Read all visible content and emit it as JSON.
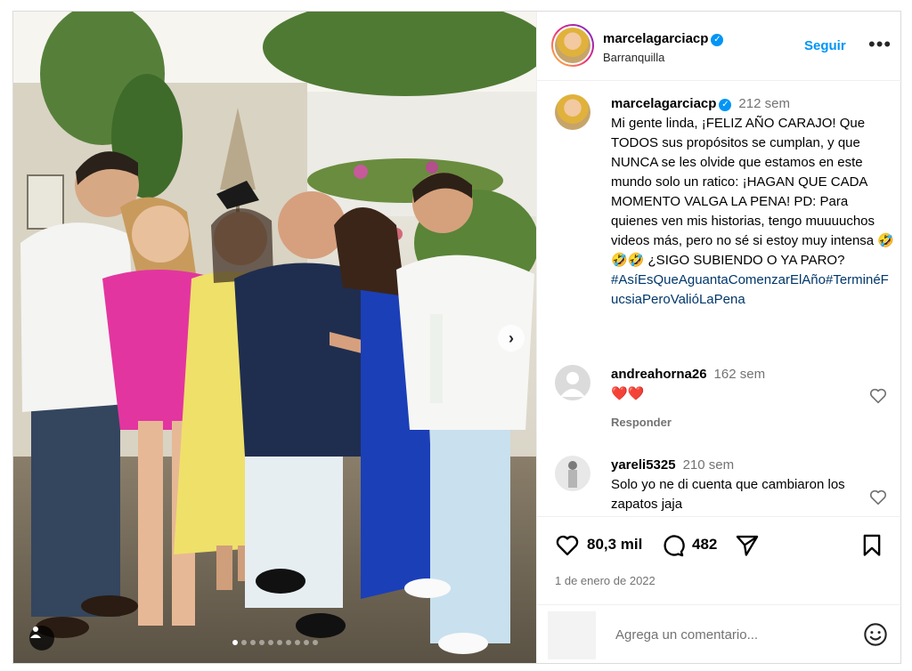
{
  "post": {
    "username": "marcelagarciacp",
    "location": "Barranquilla",
    "follow_label": "Seguir",
    "more_label": "•••",
    "next_label": "›",
    "carousel_count": 10,
    "carousel_active": 1
  },
  "caption": {
    "username": "marcelagarciacp",
    "time": "212 sem",
    "text": "Mi gente linda, ¡FELIZ AÑO CARAJO! Que TODOS sus propósitos se cumplan, y que NUNCA se les olvide que estamos en este mundo solo un ratico: ¡HAGAN QUE CADA MOMENTO VALGA LA PENA! PD: Para quienes ven mis historias, tengo muuuuchos videos más, pero no sé si estoy muy intensa 🤣🤣🤣 ¿SIGO SUBIENDO O YA PARO?",
    "hashtags": "#AsíEsQueAguantaComenzarElAño#TerminéFucsiaPeroValióLaPena"
  },
  "comments": [
    {
      "username": "andreahorna26",
      "time": "162 sem",
      "text": "❤️❤️",
      "reply_label": "Responder"
    },
    {
      "username": "yareli5325",
      "time": "210 sem",
      "text": "Solo yo ne di cuenta que cambiaron los zapatos jaja"
    }
  ],
  "stats": {
    "likes": "80,3 mil",
    "comments": "482",
    "date": "1 de enero de 2022"
  },
  "composer": {
    "placeholder": "Agrega un comentario..."
  },
  "colors": {
    "link": "#0095f6",
    "hashtag": "#00376b",
    "muted": "#737373"
  }
}
